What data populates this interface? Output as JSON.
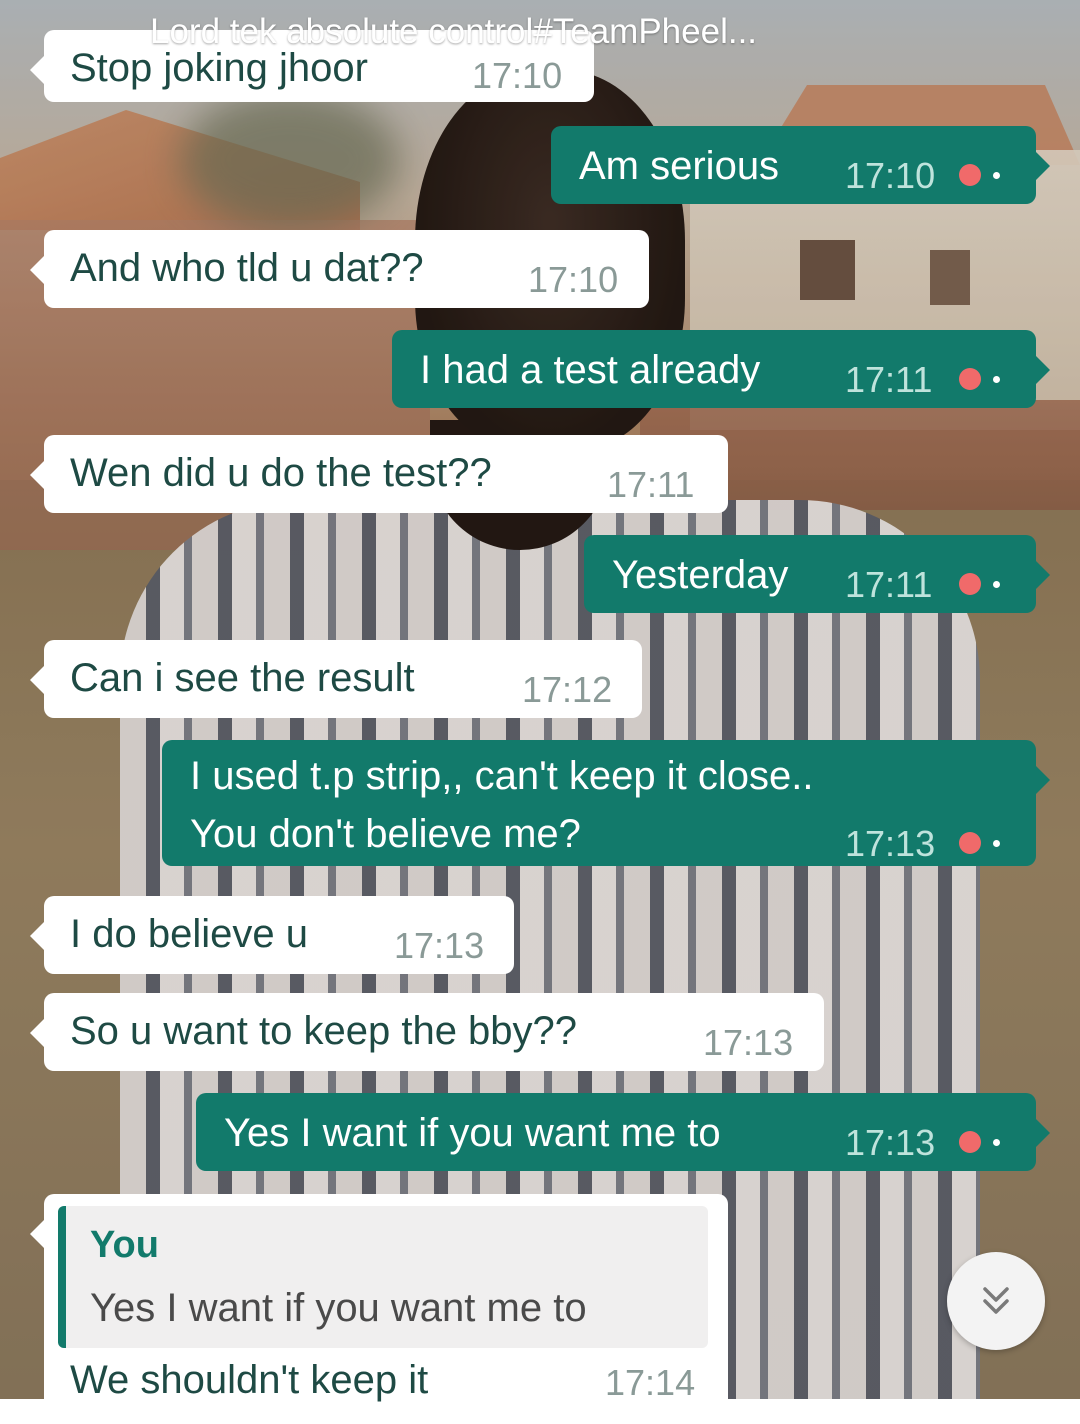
{
  "header": {
    "title": "Lord tek absolute control#TeamPheel..."
  },
  "colors": {
    "outgoing_bubble": "#127a6b",
    "incoming_bubble": "#ffffff",
    "status_indicator": "#f06a6a"
  },
  "messages": [
    {
      "direction": "in",
      "text": "Stop joking jhoor",
      "time": "17:10"
    },
    {
      "direction": "out",
      "text": "Am serious",
      "time": "17:10"
    },
    {
      "direction": "in",
      "text": "And who tld u dat??",
      "time": "17:10"
    },
    {
      "direction": "out",
      "text": "I had a test already",
      "time": "17:11"
    },
    {
      "direction": "in",
      "text": "Wen did u do the test??",
      "time": "17:11"
    },
    {
      "direction": "out",
      "text": "Yesterday",
      "time": "17:11"
    },
    {
      "direction": "in",
      "text": "Can i see the result",
      "time": "17:12"
    },
    {
      "direction": "out",
      "line1": "I used t.p strip,, can't keep it close..",
      "line2": "You don't believe me?",
      "time": "17:13"
    },
    {
      "direction": "in",
      "text": "I do believe u",
      "time": "17:13"
    },
    {
      "direction": "in",
      "text": "So u want to keep the bby??",
      "time": "17:13"
    },
    {
      "direction": "out",
      "text": "Yes I want if you want me to",
      "time": "17:13"
    },
    {
      "direction": "in",
      "quote": {
        "author": "You",
        "text": "Yes I want if you want me to"
      },
      "text": "We shouldn't keep it",
      "time": "17:14"
    }
  ],
  "scroll_button": {
    "icon": "double-chevron-down-icon"
  }
}
